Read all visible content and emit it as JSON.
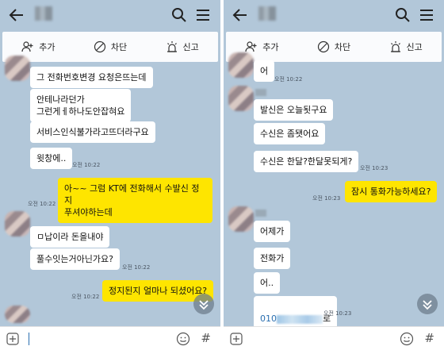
{
  "actionbar": {
    "add_label": "추가",
    "block_label": "차단",
    "report_label": "신고"
  },
  "left": {
    "messages": [
      {
        "text": "그 전화번호변경 요청은뜨는데"
      },
      {
        "text": "안테나라던가\n그런게ㅔ하나도안잡혀요"
      },
      {
        "text": "서비스인식불가라고뜨더라구요"
      },
      {
        "text": "윗창에.."
      },
      {
        "time": "오전 10:22"
      },
      {
        "text": "아~~ 그럼 KT에 전화해서 수발신 정지\n푸셔야하는데"
      },
      {
        "time": "오전 10:22"
      },
      {
        "text": "ㅁ납이라 돈을내야"
      },
      {
        "text": "풀수잇는거아닌가요?"
      },
      {
        "time": "오전 10:22"
      },
      {
        "text": "정지된지 얼마나 되셨어요?"
      },
      {
        "time": "오전 10:22"
      }
    ]
  },
  "right": {
    "messages": [
      {
        "text": "어"
      },
      {
        "time": "오전 10:22"
      },
      {
        "text": "발신은 오늘됫구요"
      },
      {
        "text": "수신은 좀됏어요"
      },
      {
        "text": "수신은 한달?한달못되게?"
      },
      {
        "time": "오전 10:23"
      },
      {
        "text": "잠시 통화가능하세요?"
      },
      {
        "time": "오전 10:23"
      },
      {
        "text": "어제가"
      },
      {
        "text": "전화가"
      },
      {
        "text": "어.."
      },
      {
        "link_prefix": "010",
        "link_suffix": "로"
      },
      {
        "time": "오전 10:23"
      }
    ]
  }
}
